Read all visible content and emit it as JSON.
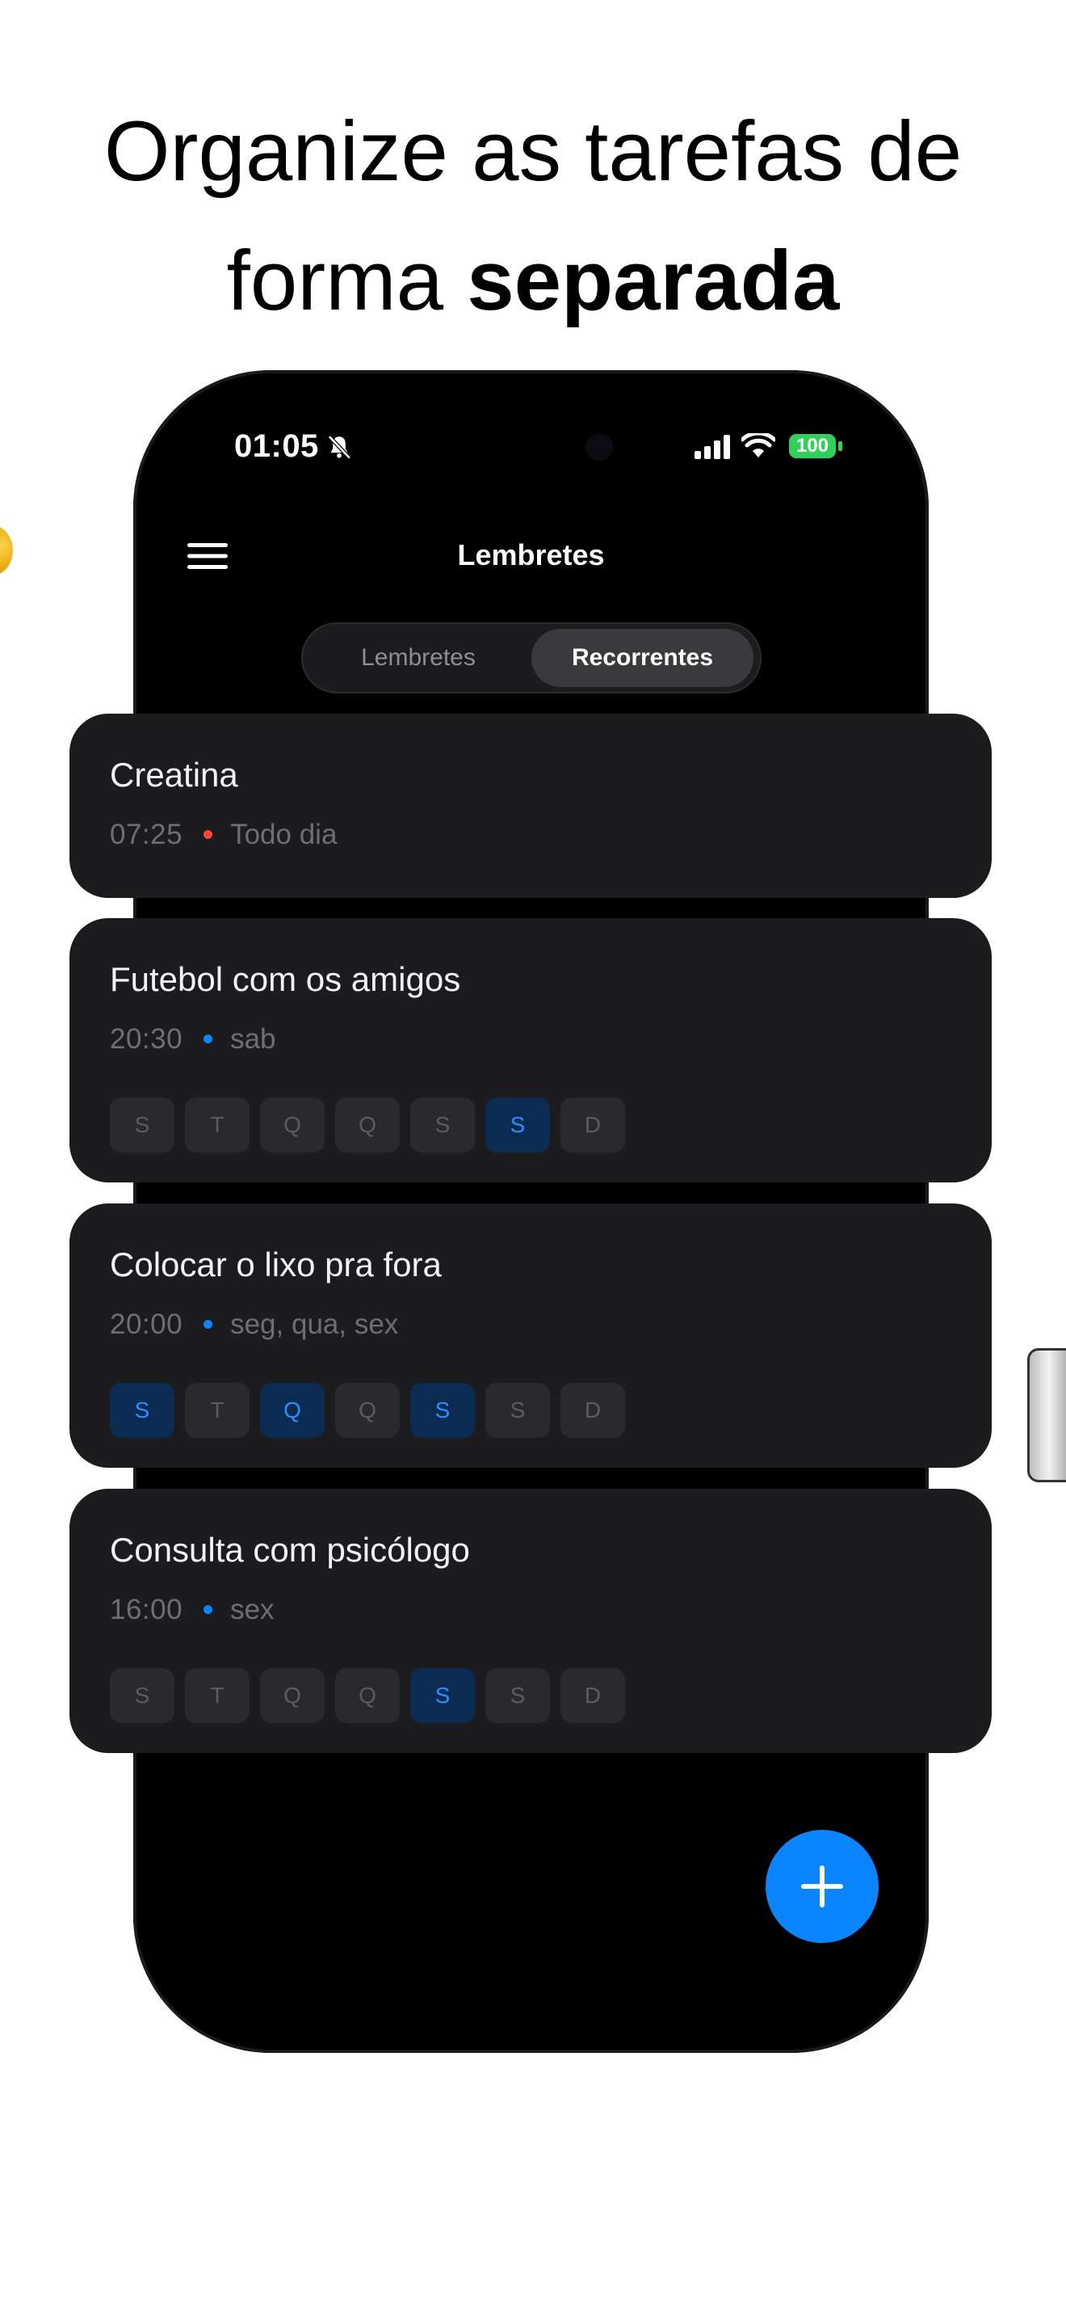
{
  "headline": {
    "line1": "Organize as tarefas de",
    "line2_regular": "forma ",
    "line2_bold": "separada"
  },
  "status_bar": {
    "time": "01:05",
    "battery": "100"
  },
  "nav": {
    "title": "Lembretes"
  },
  "segments": [
    {
      "label": "Lembretes",
      "selected": false
    },
    {
      "label": "Recorrentes",
      "selected": true
    }
  ],
  "reminders": [
    {
      "title": "Creatina",
      "time": "07:25",
      "schedule": "Todo dia",
      "dot_color": "#ff453a",
      "days": []
    },
    {
      "title": "Futebol com os amigos",
      "time": "20:30",
      "schedule": "sab",
      "dot_color": "#0a84ff",
      "days": [
        {
          "label": "S",
          "active": false
        },
        {
          "label": "T",
          "active": false
        },
        {
          "label": "Q",
          "active": false
        },
        {
          "label": "Q",
          "active": false
        },
        {
          "label": "S",
          "active": false
        },
        {
          "label": "S",
          "active": true
        },
        {
          "label": "D",
          "active": false
        }
      ]
    },
    {
      "title": "Colocar o lixo pra fora",
      "time": "20:00",
      "schedule": "seg, qua, sex",
      "dot_color": "#0a84ff",
      "days": [
        {
          "label": "S",
          "active": true
        },
        {
          "label": "T",
          "active": false
        },
        {
          "label": "Q",
          "active": true
        },
        {
          "label": "Q",
          "active": false
        },
        {
          "label": "S",
          "active": true
        },
        {
          "label": "S",
          "active": false
        },
        {
          "label": "D",
          "active": false
        }
      ]
    },
    {
      "title": "Consulta com psicólogo",
      "time": "16:00",
      "schedule": "sex",
      "dot_color": "#0a84ff",
      "days": [
        {
          "label": "S",
          "active": false
        },
        {
          "label": "T",
          "active": false
        },
        {
          "label": "Q",
          "active": false
        },
        {
          "label": "Q",
          "active": false
        },
        {
          "label": "S",
          "active": true
        },
        {
          "label": "S",
          "active": false
        },
        {
          "label": "D",
          "active": false
        }
      ]
    }
  ],
  "colors": {
    "accent": "#0a84ff",
    "card_background": "#1c1c1e",
    "active_day_background": "#0c2b52"
  },
  "icons": {
    "menu": "hamburger-menu-icon",
    "silent": "bell-slash-icon",
    "signal": "cellular-signal-icon",
    "wifi": "wifi-icon",
    "add": "plus-icon"
  }
}
